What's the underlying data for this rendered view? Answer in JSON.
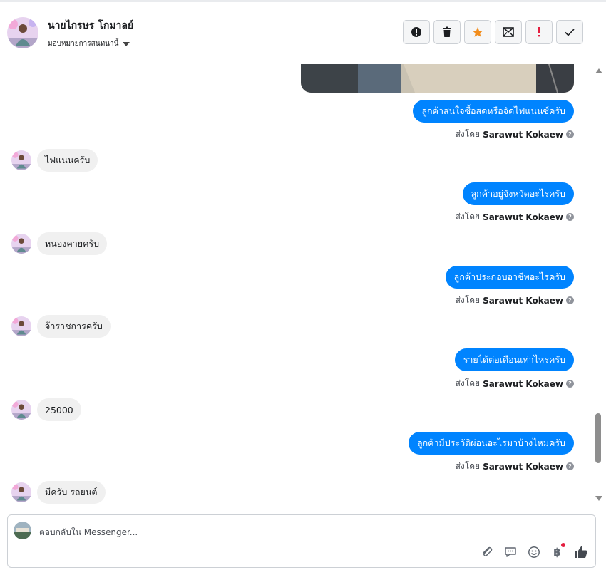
{
  "header": {
    "contact_name": "นายไกรษร โกมาลย์",
    "assign_label": "มอบหมายการสนทนานี้",
    "actions": [
      {
        "name": "report-spam-icon"
      },
      {
        "name": "delete-icon"
      },
      {
        "name": "star-icon",
        "color": "#f28d1c"
      },
      {
        "name": "mark-unread-icon"
      },
      {
        "name": "follow-up-icon",
        "color": "#e41e3f"
      },
      {
        "name": "mark-done-icon"
      }
    ]
  },
  "conversation": {
    "sent_by_prefix": "ส่งโดย",
    "sender_name": "Sarawut Kokaew",
    "messages": [
      {
        "dir": "out",
        "text": "ลูกค้าสนใจซื้อสดหรือจัดไฟแนนซ์ครับ"
      },
      {
        "dir": "in",
        "text": "ไฟแนนครับ"
      },
      {
        "dir": "out",
        "text": "ลูกค้าอยู่จังหวัดอะไรครับ"
      },
      {
        "dir": "in",
        "text": "หนองคายครับ"
      },
      {
        "dir": "out",
        "text": "ลูกค้าประกอบอาชีพอะไรครับ"
      },
      {
        "dir": "in",
        "text": "จ้าราชการครับ"
      },
      {
        "dir": "out",
        "text": "รายได้ต่อเดือนเท่าไหร่ครับ"
      },
      {
        "dir": "in",
        "text": "25000"
      },
      {
        "dir": "out",
        "text": "ลูกค้ามีประวัติผ่อนอะไรมาบ้างไหมครับ"
      },
      {
        "dir": "in",
        "text": "มีครับ รถยนต์"
      }
    ]
  },
  "composer": {
    "placeholder": "ตอบกลับใน Messenger...",
    "tools": [
      "attach-icon",
      "saved-reply-icon",
      "emoji-icon",
      "payment-icon",
      "like-icon"
    ]
  },
  "colors": {
    "outgoing_bubble": "#0084ff",
    "incoming_bubble": "#f0f0f0"
  }
}
